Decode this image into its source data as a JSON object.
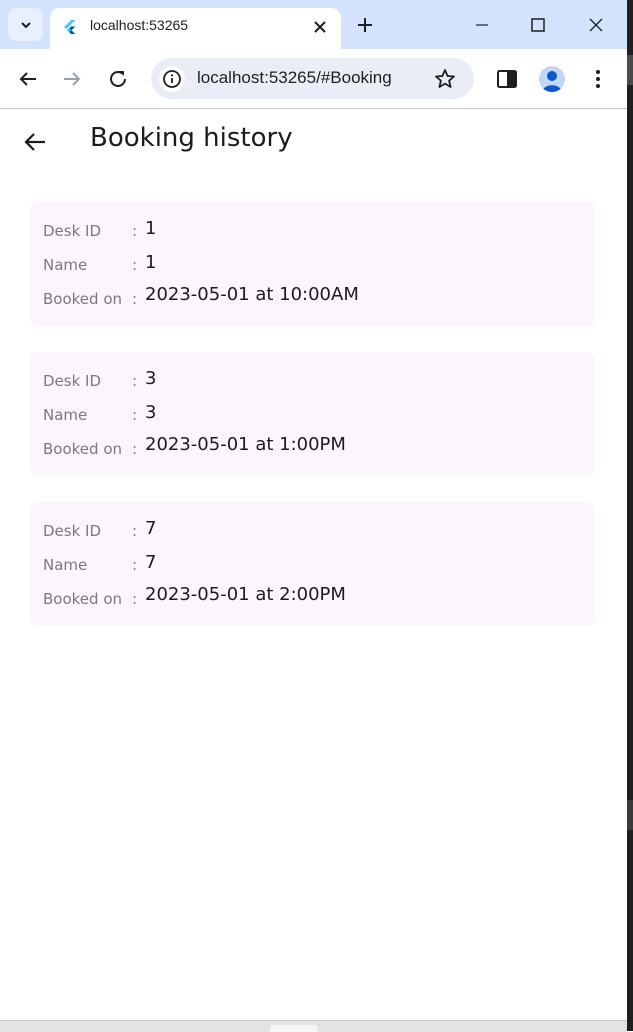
{
  "browser": {
    "tab_title": "localhost:53265",
    "url": "localhost:53265/#Booking",
    "accent_color": "#d3e3fd"
  },
  "app": {
    "title": "Booking history",
    "labels": {
      "desk_id": "Desk ID",
      "name": "Name",
      "booked_on": "Booked on",
      "separator": ":"
    },
    "bookings": [
      {
        "desk_id": "1",
        "name": "1",
        "booked_on": "2023-05-01 at 10:00AM"
      },
      {
        "desk_id": "3",
        "name": "3",
        "booked_on": "2023-05-01 at 1:00PM"
      },
      {
        "desk_id": "7",
        "name": "7",
        "booked_on": "2023-05-01 at 2:00PM"
      }
    ]
  }
}
